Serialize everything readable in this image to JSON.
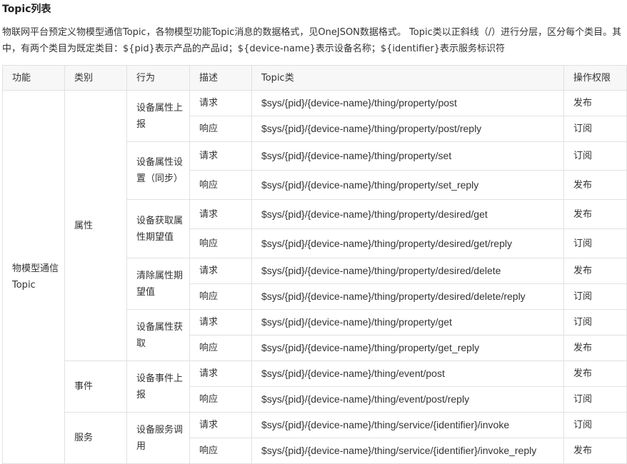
{
  "title": "Topic列表",
  "intro": "物联网平台预定义物模型通信Topic，各物模型功能Topic消息的数据格式，见OneJSON数据格式。 Topic类以正斜线（/）进行分层，区分每个类目。其中，有两个类目为既定类目：${pid}表示产品的产品id；${device-name}表示设备名称；${identifier}表示服务标识符",
  "table": {
    "headers": [
      "功能",
      "类别",
      "行为",
      "描述",
      "Topic类",
      "操作权限"
    ],
    "function": "物模型通信Topic",
    "categories": {
      "property": "属性",
      "event": "事件",
      "service": "服务"
    },
    "behaviors": [
      {
        "label": "设备属性上报",
        "rows": [
          {
            "desc": "请求",
            "topic": "$sys/{pid}/{device-name}/thing/property/post",
            "perm": "发布"
          },
          {
            "desc": "响应",
            "topic": "$sys/{pid}/{device-name}/thing/property/post/reply",
            "perm": "订阅"
          }
        ]
      },
      {
        "label": "设备属性设置（同步）",
        "rows": [
          {
            "desc": "请求",
            "topic": "$sys/{pid}/{device-name}/thing/property/set",
            "perm": "订阅"
          },
          {
            "desc": "响应",
            "topic": "$sys/{pid}/{device-name}/thing/property/set_reply",
            "perm": "发布"
          }
        ]
      },
      {
        "label": "设备获取属性期望值",
        "rows": [
          {
            "desc": "请求",
            "topic": "$sys/{pid}/{device-name}/thing/property/desired/get",
            "perm": "发布"
          },
          {
            "desc": "响应",
            "topic": "$sys/{pid}/{device-name}/thing/property/desired/get/reply",
            "perm": "订阅"
          }
        ]
      },
      {
        "label": "清除属性期望值",
        "rows": [
          {
            "desc": "请求",
            "topic": "$sys/{pid}/{device-name}/thing/property/desired/delete",
            "perm": "发布"
          },
          {
            "desc": "响应",
            "topic": "$sys/{pid}/{device-name}/thing/property/desired/delete/reply",
            "perm": "订阅"
          }
        ]
      },
      {
        "label": "设备属性获取",
        "rows": [
          {
            "desc": "请求",
            "topic": "$sys/{pid}/{device-name}/thing/property/get",
            "perm": "订阅"
          },
          {
            "desc": "响应",
            "topic": "$sys/{pid}/{device-name}/thing/property/get_reply",
            "perm": "发布"
          }
        ]
      },
      {
        "label": "设备事件上报",
        "rows": [
          {
            "desc": "请求",
            "topic": "$sys/{pid}/{device-name}/thing/event/post",
            "perm": "发布"
          },
          {
            "desc": "响应",
            "topic": "$sys/{pid}/{device-name}/thing/event/post/reply",
            "perm": "订阅"
          }
        ]
      },
      {
        "label": "设备服务调用",
        "rows": [
          {
            "desc": "请求",
            "topic": "$sys/{pid}/{device-name}/thing/service/{identifier}/invoke",
            "perm": "订阅"
          },
          {
            "desc": "响应",
            "topic": "$sys/{pid}/{device-name}/thing/service/{identifier}/invoke_reply",
            "perm": "发布"
          }
        ]
      }
    ]
  }
}
